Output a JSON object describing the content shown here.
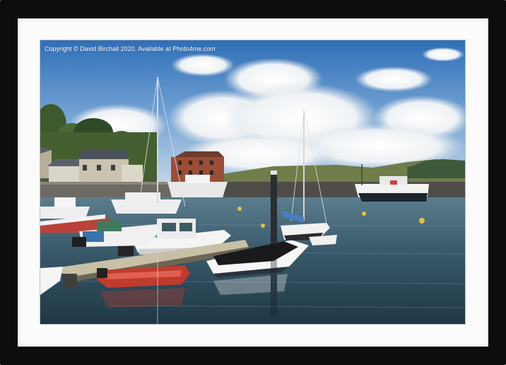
{
  "photo": {
    "copyright_text": "Copyright  © David Birchall  2020. Available at Photo4me.com"
  },
  "colors": {
    "frame": "#0d0d0d",
    "mount": "#fbfbfb",
    "sky": "#3f7fc4",
    "water": "#2d4a5a"
  }
}
